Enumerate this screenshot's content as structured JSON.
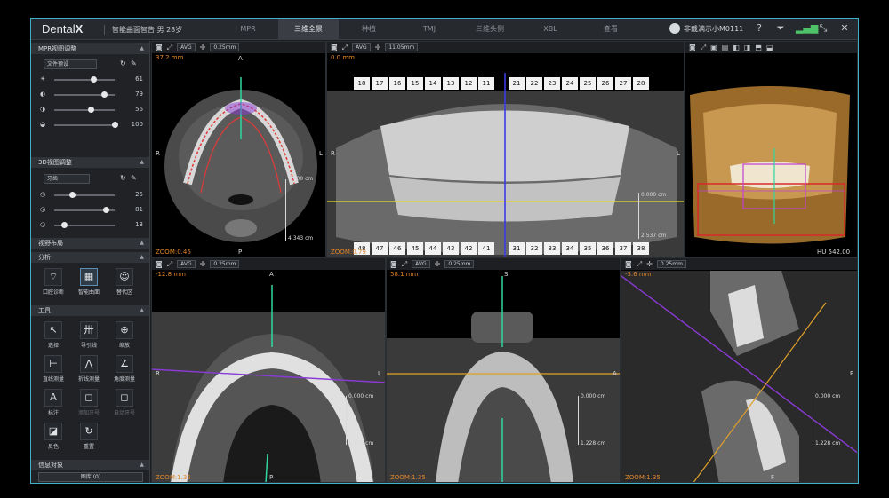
{
  "app": {
    "logo": "Dental",
    "logo_mark": "X",
    "patient": "智能曲面智告 男 28岁"
  },
  "tabs": [
    {
      "label": "MPR"
    },
    {
      "label": "三维全景"
    },
    {
      "label": "种植"
    },
    {
      "label": "TMJ"
    },
    {
      "label": "三维头侧"
    },
    {
      "label": "XBL"
    },
    {
      "label": "查看"
    }
  ],
  "user": {
    "name": "非戴满示小M0111"
  },
  "sidebar": {
    "mpr_title": "MPR视图调整",
    "mpr_preset": "文件预设",
    "mpr_sliders": [
      {
        "icon": "☀",
        "value": "61",
        "level": 0.65
      },
      {
        "icon": "◐",
        "value": "79",
        "level": 0.82
      },
      {
        "icon": "◑",
        "value": "56",
        "level": 0.6
      },
      {
        "icon": "◒",
        "value": "100",
        "level": 1.0
      }
    ],
    "view3d_title": "3D视图调整",
    "view3d_preset": "牙齿",
    "view3d_sliders": [
      {
        "icon": "◷",
        "value": "25",
        "level": 0.3
      },
      {
        "icon": "◶",
        "value": "81",
        "level": 0.85
      },
      {
        "icon": "◵",
        "value": "13",
        "level": 0.16
      }
    ],
    "layout_title": "视野布局",
    "analysis_title": "分析",
    "analysis": [
      {
        "label": "口腔诊断",
        "glyph": "⌔"
      },
      {
        "label": "智能曲面",
        "glyph": "▦"
      },
      {
        "label": "替代区",
        "glyph": "☺"
      }
    ],
    "tools_title": "工具",
    "tools": [
      {
        "label": "选择",
        "glyph": "↖",
        "dim": false
      },
      {
        "label": "导引线",
        "glyph": "卅",
        "dim": false
      },
      {
        "label": "缩放",
        "glyph": "⊕",
        "dim": false
      },
      {
        "label": "直线测量",
        "glyph": "⊢",
        "dim": false
      },
      {
        "label": "折线测量",
        "glyph": "⋀",
        "dim": false
      },
      {
        "label": "角度测量",
        "glyph": "∠",
        "dim": false
      },
      {
        "label": "标注",
        "glyph": "Ａ",
        "dim": false
      },
      {
        "label": "添加牙号",
        "glyph": "◻",
        "dim": true
      },
      {
        "label": "自动牙号",
        "glyph": "◻",
        "dim": true
      },
      {
        "label": "反色",
        "glyph": "◪",
        "dim": false
      },
      {
        "label": "重置",
        "glyph": "↻",
        "dim": false
      }
    ],
    "objects_title": "信息对象",
    "library_button": "图库 (0)"
  },
  "panels": {
    "axial_top": {
      "depth": "37.2 mm",
      "dir_a": "A",
      "dir_r": "R",
      "dir_l": "L",
      "zoom": "ZOOM:0.46",
      "dir_p": "P",
      "scale1": "0.000 cm",
      "scale2": "4.343 cm",
      "thickness": "0.25mm",
      "mode": "AVG"
    },
    "panoramic": {
      "depth": "0.0 mm",
      "dir_r": "R",
      "dir_l": "L",
      "zoom": "ZOOM:0.79",
      "scale1": "0.000 cm",
      "scale2": "2.537 cm",
      "thickness": "11.05mm",
      "mode": "AVG",
      "upper_teeth": [
        "18",
        "17",
        "16",
        "15",
        "14",
        "13",
        "12",
        "11",
        "21",
        "22",
        "23",
        "24",
        "25",
        "26",
        "27",
        "28"
      ],
      "lower_teeth": [
        "48",
        "47",
        "46",
        "45",
        "44",
        "43",
        "42",
        "41",
        "31",
        "32",
        "33",
        "34",
        "35",
        "36",
        "37",
        "38"
      ]
    },
    "volume": {
      "hu": "HU 542.00"
    },
    "axial_bottom": {
      "depth": "-12.8 mm",
      "dir_a": "A",
      "dir_r": "R",
      "dir_l": "L",
      "dir_p": "P",
      "zoom": "ZOOM:1.35",
      "scale1": "0.000 cm",
      "scale2": "1.228 cm",
      "thickness": "0.25mm",
      "mode": "AVG"
    },
    "coronal": {
      "depth": "58.1 mm",
      "dir_s": "S",
      "dir_a": "A",
      "zoom": "ZOOM:1.35",
      "scale1": "0.000 cm",
      "scale2": "1.228 cm",
      "thickness": "0.25mm",
      "mode": "AVG"
    },
    "sagittal": {
      "depth": "-3.6 mm",
      "dir_p": "P",
      "dir_f": "F",
      "zoom": "ZOOM:1.35",
      "scale1": "0.000 cm",
      "scale2": "1.228 cm",
      "thickness": "0.25mm"
    }
  },
  "colors": {
    "accent": "#3fb2c9",
    "orange": "#e0852a",
    "green_line": "#2fd6a0",
    "purple_line": "#8a3ad6",
    "yellow_line": "#e6d62a",
    "blue_line": "#3a3ae6",
    "red_curve": "#e03a3a"
  }
}
